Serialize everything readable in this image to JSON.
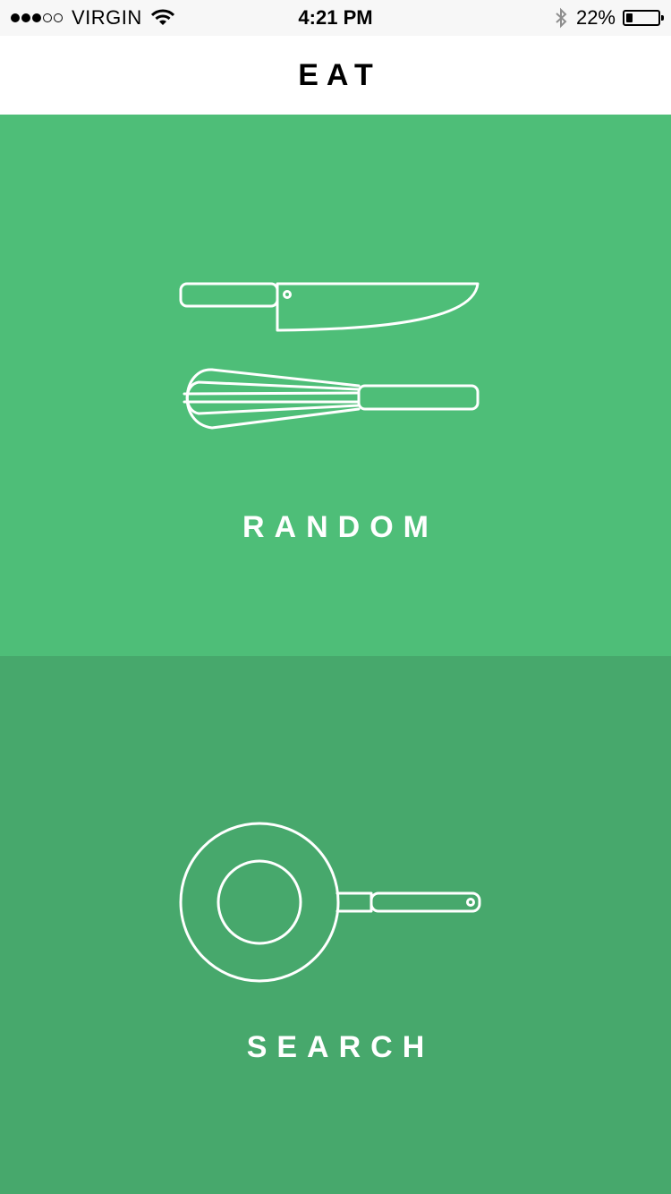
{
  "status_bar": {
    "carrier": "VIRGIN",
    "signal_bars": 3,
    "signal_total": 5,
    "time": "4:21 PM",
    "battery_percent_label": "22%",
    "battery_level": 0.22,
    "icons": [
      "signal-dots-icon",
      "wifi-icon",
      "bluetooth-icon",
      "battery-icon"
    ]
  },
  "nav": {
    "title": "EAT"
  },
  "panels": {
    "random": {
      "label": "RANDOM",
      "icons": [
        "knife-icon",
        "whisk-icon"
      ],
      "background": "#4ebe78"
    },
    "search": {
      "label": "SEARCH",
      "icons": [
        "frying-pan-icon"
      ],
      "background": "#47a86c"
    }
  },
  "colors": {
    "line": "#ffffff",
    "nav_background": "#ffffff",
    "status_background": "#f7f7f7"
  }
}
